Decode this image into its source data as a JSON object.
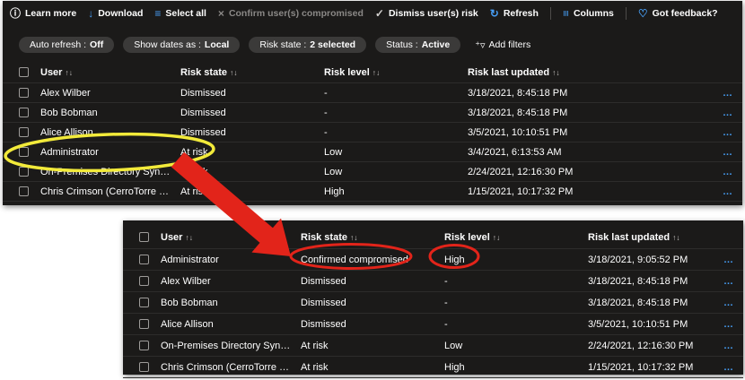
{
  "colors": {
    "panel_bg": "#1b1a19",
    "accent_blue": "#479ef5",
    "disabled_text": "#8a8886",
    "pill_bg": "#3b3a39",
    "row_divider": "#2d2c2b",
    "annotation_red": "#e2241a",
    "annotation_yellow": "#f2ea3a"
  },
  "toolbar": {
    "items": [
      {
        "label": "Learn more",
        "glyph": "ⓘ"
      },
      {
        "label": "Download",
        "glyph": "↓"
      },
      {
        "label": "Select all",
        "glyph": "≡"
      },
      {
        "label": "Confirm user(s) compromised",
        "glyph": "×"
      },
      {
        "label": "Dismiss user(s) risk",
        "glyph": "✓"
      },
      {
        "label": "Refresh",
        "glyph": "↻"
      },
      {
        "label": "Columns",
        "glyph": "≡"
      },
      {
        "label": "Got feedback?",
        "glyph": "♡"
      }
    ]
  },
  "filters": {
    "pills": [
      {
        "label": "Auto refresh :",
        "value": "Off"
      },
      {
        "label": "Show dates as :",
        "value": "Local"
      },
      {
        "label": "Risk state :",
        "value": "2 selected"
      },
      {
        "label": "Status :",
        "value": "Active"
      }
    ],
    "add_filters": {
      "label": "Add filters",
      "glyph": "⁺▿"
    }
  },
  "table": {
    "sort_glyph": "↑↓",
    "more_glyph": "…",
    "columns": {
      "user": "User",
      "risk_state": "Risk state",
      "risk_level": "Risk level",
      "risk_last_updated": "Risk last updated"
    }
  },
  "table_top": {
    "rows": [
      {
        "user": "Alex Wilber",
        "risk_state": "Dismissed",
        "risk_level": "-",
        "risk_last_updated": "3/18/2021, 8:45:18 PM"
      },
      {
        "user": "Bob Bobman",
        "risk_state": "Dismissed",
        "risk_level": "-",
        "risk_last_updated": "3/18/2021, 8:45:18 PM"
      },
      {
        "user": "Alice Allison",
        "risk_state": "Dismissed",
        "risk_level": "-",
        "risk_last_updated": "3/5/2021, 10:10:51 PM"
      },
      {
        "user": "Administrator",
        "risk_state": "At risk",
        "risk_level": "Low",
        "risk_last_updated": "3/4/2021, 6:13:53 AM"
      },
      {
        "user": "On-Premises Directory Synchronizati...",
        "risk_state": "At risk",
        "risk_level": "Low",
        "risk_last_updated": "2/24/2021, 12:16:30 PM"
      },
      {
        "user": "Chris Crimson (CerroTorre Software)",
        "risk_state": "At risk",
        "risk_level": "High",
        "risk_last_updated": "1/15/2021, 10:17:32 PM"
      }
    ]
  },
  "table_bottom": {
    "rows": [
      {
        "user": "Administrator",
        "risk_state": "Confirmed compromised",
        "risk_level": "High",
        "risk_last_updated": "3/18/2021, 9:05:52 PM"
      },
      {
        "user": "Alex Wilber",
        "risk_state": "Dismissed",
        "risk_level": "-",
        "risk_last_updated": "3/18/2021, 8:45:18 PM"
      },
      {
        "user": "Bob Bobman",
        "risk_state": "Dismissed",
        "risk_level": "-",
        "risk_last_updated": "3/18/2021, 8:45:18 PM"
      },
      {
        "user": "Alice Allison",
        "risk_state": "Dismissed",
        "risk_level": "-",
        "risk_last_updated": "3/5/2021, 10:10:51 PM"
      },
      {
        "user": "On-Premises Directory Synchronizati...",
        "risk_state": "At risk",
        "risk_level": "Low",
        "risk_last_updated": "2/24/2021, 12:16:30 PM"
      },
      {
        "user": "Chris Crimson (CerroTorre Software)",
        "risk_state": "At risk",
        "risk_level": "High",
        "risk_last_updated": "1/15/2021, 10:17:32 PM"
      }
    ]
  }
}
